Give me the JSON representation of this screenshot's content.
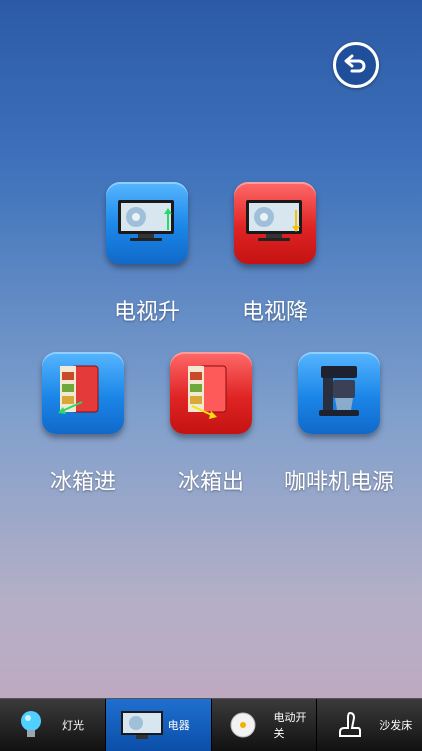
{
  "screen": {
    "tiles": [
      {
        "label": "电视升",
        "color": "blue",
        "icon": "tv-up-icon"
      },
      {
        "label": "电视降",
        "color": "red",
        "icon": "tv-down-icon"
      },
      {
        "label": "冰箱进",
        "color": "blue",
        "icon": "fridge-in-icon"
      },
      {
        "label": "冰箱出",
        "color": "red",
        "icon": "fridge-out-icon"
      },
      {
        "label": "咖啡机电源",
        "color": "blue",
        "icon": "coffee-machine-icon"
      }
    ]
  },
  "navbar": {
    "items": [
      {
        "label": "灯光",
        "icon": "light-bulb-icon"
      },
      {
        "label": "电器",
        "icon": "tv-icon",
        "active": true
      },
      {
        "label": "电动开关",
        "icon": "switch-icon"
      },
      {
        "label": "沙发床",
        "icon": "sofa-bed-icon"
      }
    ]
  },
  "colors": {
    "tile_blue": "#1b86e8",
    "tile_red": "#e02424",
    "nav_active": "#0b4fa8"
  }
}
